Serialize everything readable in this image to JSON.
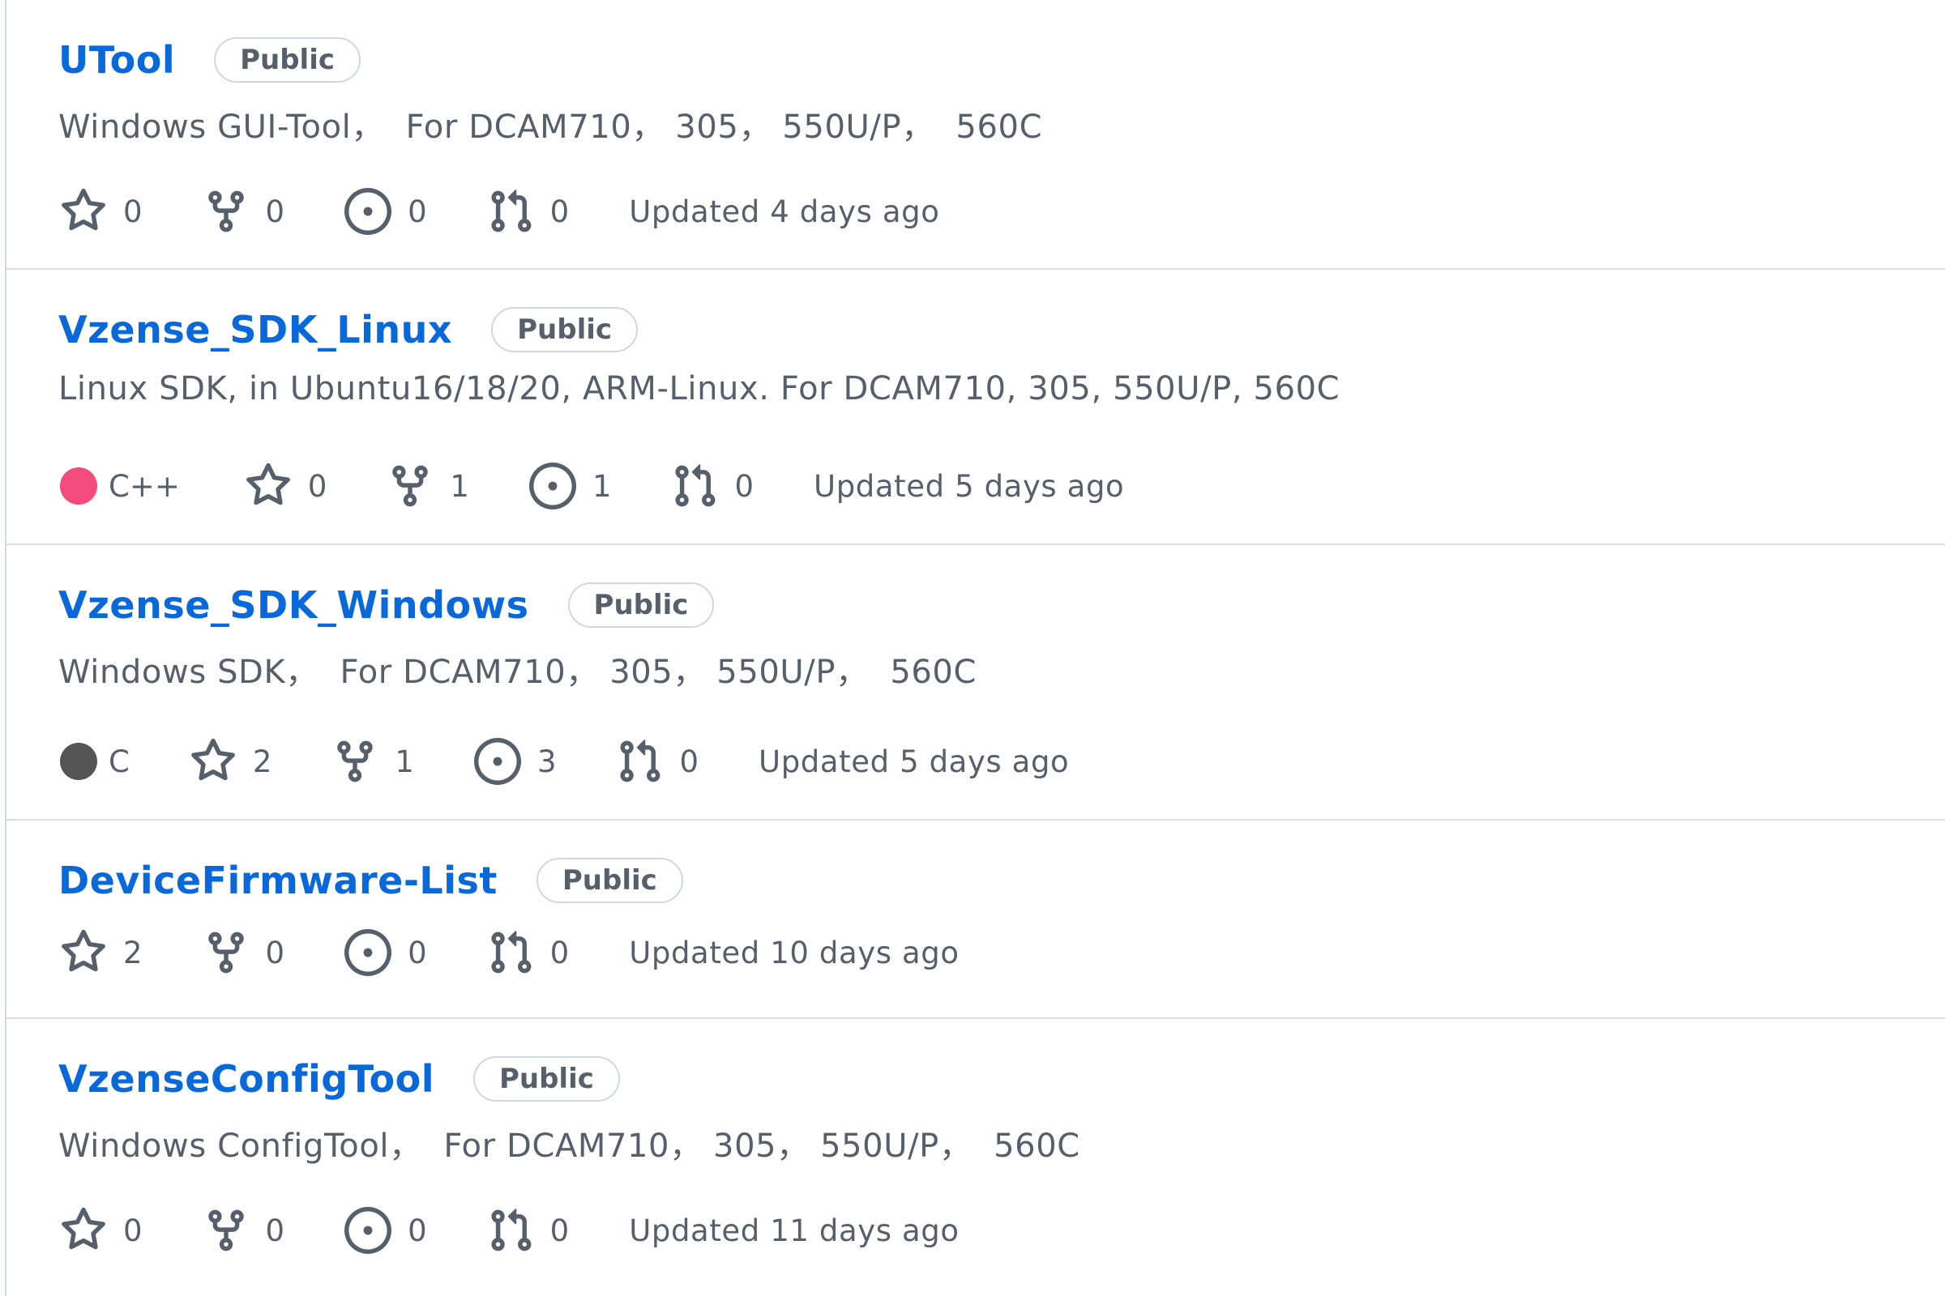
{
  "repos": [
    {
      "name": "UTool",
      "visibility": "Public",
      "description": "Windows GUI-Tool，  For DCAM710， 305， 550U/P，  560C",
      "language": null,
      "language_color": null,
      "stars": "0",
      "forks": "0",
      "issues": "0",
      "pulls": "0",
      "updated": "Updated 4 days ago"
    },
    {
      "name": "Vzense_SDK_Linux",
      "visibility": "Public",
      "description": "Linux SDK, in Ubuntu16/18/20, ARM-Linux. For DCAM710, 305, 550U/P, 560C",
      "language": "C++",
      "language_color": "#f34b7d",
      "stars": "0",
      "forks": "1",
      "issues": "1",
      "pulls": "0",
      "updated": "Updated 5 days ago"
    },
    {
      "name": "Vzense_SDK_Windows",
      "visibility": "Public",
      "description": "Windows SDK，  For DCAM710， 305， 550U/P，  560C",
      "language": "C",
      "language_color": "#555555",
      "stars": "2",
      "forks": "1",
      "issues": "3",
      "pulls": "0",
      "updated": "Updated 5 days ago"
    },
    {
      "name": "DeviceFirmware-List",
      "visibility": "Public",
      "description": "",
      "language": null,
      "language_color": null,
      "stars": "2",
      "forks": "0",
      "issues": "0",
      "pulls": "0",
      "updated": "Updated 10 days ago"
    },
    {
      "name": "VzenseConfigTool",
      "visibility": "Public",
      "description": "Windows ConfigTool，  For DCAM710， 305， 550U/P，  560C",
      "language": null,
      "language_color": null,
      "stars": "0",
      "forks": "0",
      "issues": "0",
      "pulls": "0",
      "updated": "Updated 11 days ago"
    }
  ],
  "icons": {
    "star": "star-icon",
    "fork": "repo-forked-icon",
    "issue": "issue-opened-icon",
    "pull": "git-pull-request-icon"
  },
  "colors": {
    "link": "#0969da",
    "muted": "#57606a",
    "border": "#d0d7de"
  }
}
